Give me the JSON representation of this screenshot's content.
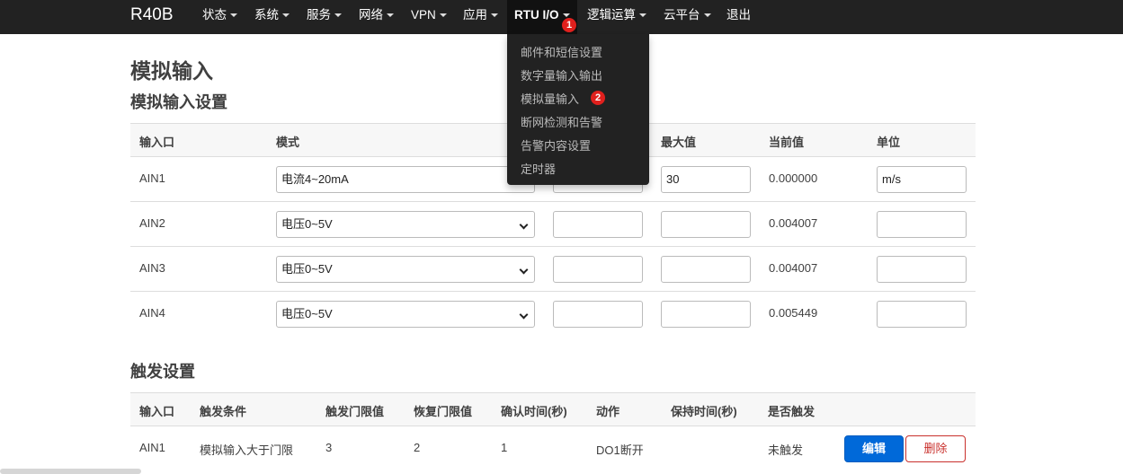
{
  "navbar": {
    "brand": "R40B",
    "items": [
      {
        "label": "状态"
      },
      {
        "label": "系统"
      },
      {
        "label": "服务"
      },
      {
        "label": "网络"
      },
      {
        "label": "VPN"
      },
      {
        "label": "应用"
      },
      {
        "label": "RTU I/O"
      },
      {
        "label": "逻辑运算"
      },
      {
        "label": "云平台"
      },
      {
        "label": "退出"
      }
    ]
  },
  "badges": {
    "one": "1",
    "two": "2"
  },
  "dropdown": {
    "items": [
      "邮件和短信设置",
      "数字量输入输出",
      "模拟量输入",
      "断网检测和告警",
      "告警内容设置",
      "定时器"
    ]
  },
  "page": {
    "title": "模拟输入",
    "section1": "模拟输入设置",
    "section2": "触发设置"
  },
  "analog_table": {
    "headers": [
      "输入口",
      "模式",
      "最大值",
      "当前值",
      "单位"
    ],
    "rows": [
      {
        "port": "AIN1",
        "mode": "电流4~20mA",
        "min": "",
        "max": "30",
        "current": "0.000000",
        "unit": "m/s"
      },
      {
        "port": "AIN2",
        "mode": "电压0~5V",
        "min": "",
        "max": "",
        "current": "0.004007",
        "unit": ""
      },
      {
        "port": "AIN3",
        "mode": "电压0~5V",
        "min": "",
        "max": "",
        "current": "0.004007",
        "unit": ""
      },
      {
        "port": "AIN4",
        "mode": "电压0~5V",
        "min": "",
        "max": "",
        "current": "0.005449",
        "unit": ""
      }
    ]
  },
  "trigger_table": {
    "headers": [
      "输入口",
      "触发条件",
      "触发门限值",
      "恢复门限值",
      "确认时间(秒)",
      "动作",
      "保持时间(秒)",
      "是否触发"
    ],
    "rows": [
      {
        "port": "AIN1",
        "condition": "模拟输入大于门限",
        "trigger": "3",
        "recover": "2",
        "confirm": "1",
        "action": "DO1断开",
        "hold": "",
        "triggered": "未触发",
        "edit": "编辑",
        "delete": "删除"
      }
    ]
  },
  "colors": {
    "navbar": "#222222",
    "edit_button": "#0069d9",
    "delete_button": "#c9302c",
    "badge": "#e0201d"
  }
}
